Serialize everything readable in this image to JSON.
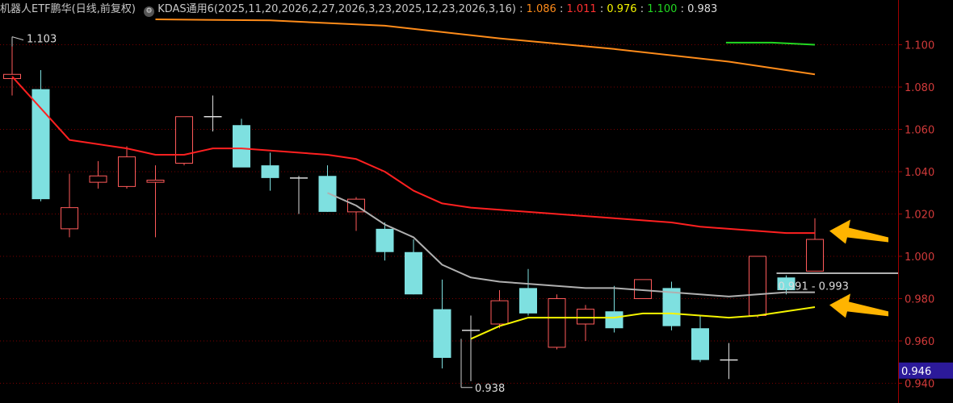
{
  "header": {
    "title": "机器人ETF鹏华(日线,前复权)",
    "indicator": "KDAS通用6(2025,11,20,2026,2,27,2026,3,23,2025,12,23,2026,3,16)",
    "values": [
      {
        "text": "1.086",
        "color": "#ff8c1a"
      },
      {
        "text": "1.011",
        "color": "#ff3030"
      },
      {
        "text": "0.976",
        "color": "#f5f500"
      },
      {
        "text": "1.100",
        "color": "#22d822"
      },
      {
        "text": "0.983",
        "color": "#dddddd"
      }
    ]
  },
  "colors": {
    "up": "#ff5a5a",
    "down": "#7ee0e0",
    "orange": "#ff8c1a",
    "red": "#ff2020",
    "yellow": "#f5f500",
    "green": "#22d822",
    "gray": "#b0b0b0",
    "grid": "#7a0000",
    "arrow": "#ffb400"
  },
  "chart_data": {
    "type": "candlestick",
    "ylim": [
      0.936,
      1.112
    ],
    "yticks": [
      "1.100",
      "1.080",
      "1.060",
      "1.040",
      "1.020",
      "1.000",
      "0.980",
      "0.960",
      "0.940"
    ],
    "current_price_label": "0.946",
    "annotations": {
      "high": "1.103",
      "low": "0.938",
      "range": "0.991 - 0.993"
    },
    "candles": [
      {
        "o": 1.084,
        "h": 1.103,
        "l": 1.076,
        "c": 1.086
      },
      {
        "o": 1.079,
        "h": 1.088,
        "l": 1.026,
        "c": 1.027
      },
      {
        "o": 1.013,
        "h": 1.039,
        "l": 1.009,
        "c": 1.023
      },
      {
        "o": 1.035,
        "h": 1.045,
        "l": 1.032,
        "c": 1.038
      },
      {
        "o": 1.033,
        "h": 1.052,
        "l": 1.032,
        "c": 1.047
      },
      {
        "o": 1.035,
        "h": 1.043,
        "l": 1.009,
        "c": 1.036
      },
      {
        "o": 1.044,
        "h": 1.066,
        "l": 1.043,
        "c": 1.066
      },
      {
        "o": 1.066,
        "h": 1.076,
        "l": 1.059,
        "c": 1.066
      },
      {
        "o": 1.062,
        "h": 1.065,
        "l": 1.045,
        "c": 1.042
      },
      {
        "o": 1.043,
        "h": 1.049,
        "l": 1.031,
        "c": 1.037
      },
      {
        "o": 1.037,
        "h": 1.038,
        "l": 1.02,
        "c": 1.037
      },
      {
        "o": 1.038,
        "h": 1.043,
        "l": 1.021,
        "c": 1.021
      },
      {
        "o": 1.021,
        "h": 1.028,
        "l": 1.012,
        "c": 1.027
      },
      {
        "o": 1.013,
        "h": 1.016,
        "l": 0.998,
        "c": 1.002
      },
      {
        "o": 1.002,
        "h": 1.008,
        "l": 0.982,
        "c": 0.982
      },
      {
        "o": 0.975,
        "h": 0.989,
        "l": 0.947,
        "c": 0.952
      },
      {
        "o": 0.965,
        "h": 0.972,
        "l": 0.941,
        "c": 0.965
      },
      {
        "o": 0.968,
        "h": 0.984,
        "l": 0.966,
        "c": 0.979
      },
      {
        "o": 0.985,
        "h": 0.994,
        "l": 0.972,
        "c": 0.973
      },
      {
        "o": 0.957,
        "h": 0.982,
        "l": 0.956,
        "c": 0.98
      },
      {
        "o": 0.968,
        "h": 0.977,
        "l": 0.96,
        "c": 0.975
      },
      {
        "o": 0.974,
        "h": 0.986,
        "l": 0.964,
        "c": 0.966
      },
      {
        "o": 0.98,
        "h": 0.989,
        "l": 0.98,
        "c": 0.989
      },
      {
        "o": 0.985,
        "h": 0.988,
        "l": 0.965,
        "c": 0.967
      },
      {
        "o": 0.966,
        "h": 0.972,
        "l": 0.95,
        "c": 0.951
      },
      {
        "o": 0.951,
        "h": 0.959,
        "l": 0.942,
        "c": 0.951
      },
      {
        "o": 0.972,
        "h": 1.0,
        "l": 0.971,
        "c": 1.0
      },
      {
        "o": 0.99,
        "h": 0.991,
        "l": 0.982,
        "c": 0.984
      },
      {
        "o": 0.993,
        "h": 1.018,
        "l": 0.993,
        "c": 1.008
      }
    ],
    "series": [
      {
        "color_key": "orange",
        "points": [
          [
            5,
            1.112
          ],
          [
            9,
            1.1115
          ],
          [
            13,
            1.109
          ],
          [
            17,
            1.103
          ],
          [
            21,
            1.098
          ],
          [
            25,
            1.092
          ],
          [
            28,
            1.086
          ]
        ]
      },
      {
        "color_key": "red",
        "points": [
          [
            0,
            1.085
          ],
          [
            1,
            1.07
          ],
          [
            2,
            1.055
          ],
          [
            3,
            1.053
          ],
          [
            4,
            1.051
          ],
          [
            5,
            1.048
          ],
          [
            6,
            1.048
          ],
          [
            7,
            1.051
          ],
          [
            8,
            1.051
          ],
          [
            9,
            1.05
          ],
          [
            10,
            1.049
          ],
          [
            11,
            1.048
          ],
          [
            12,
            1.046
          ],
          [
            13,
            1.04
          ],
          [
            14,
            1.031
          ],
          [
            15,
            1.025
          ],
          [
            16,
            1.023
          ],
          [
            17,
            1.022
          ],
          [
            18,
            1.021
          ],
          [
            19,
            1.02
          ],
          [
            20,
            1.019
          ],
          [
            21,
            1.018
          ],
          [
            22,
            1.017
          ],
          [
            23,
            1.016
          ],
          [
            24,
            1.014
          ],
          [
            25,
            1.013
          ],
          [
            26,
            1.012
          ],
          [
            27,
            1.011
          ],
          [
            28,
            1.011
          ]
        ]
      },
      {
        "color_key": "gray",
        "points": [
          [
            11,
            1.03
          ],
          [
            12,
            1.024
          ],
          [
            13,
            1.015
          ],
          [
            14,
            1.009
          ],
          [
            15,
            0.996
          ],
          [
            16,
            0.99
          ],
          [
            17,
            0.988
          ],
          [
            18,
            0.987
          ],
          [
            19,
            0.986
          ],
          [
            20,
            0.985
          ],
          [
            21,
            0.985
          ],
          [
            22,
            0.984
          ],
          [
            23,
            0.983
          ],
          [
            24,
            0.982
          ],
          [
            25,
            0.981
          ],
          [
            26,
            0.982
          ],
          [
            27,
            0.983
          ],
          [
            28,
            0.983
          ]
        ]
      },
      {
        "color_key": "yellow",
        "points": [
          [
            16,
            0.961
          ],
          [
            17,
            0.967
          ],
          [
            18,
            0.971
          ],
          [
            19,
            0.971
          ],
          [
            20,
            0.971
          ],
          [
            21,
            0.971
          ],
          [
            22,
            0.973
          ],
          [
            23,
            0.973
          ],
          [
            24,
            0.972
          ],
          [
            25,
            0.971
          ],
          [
            26,
            0.972
          ],
          [
            27,
            0.974
          ],
          [
            28,
            0.976
          ]
        ]
      },
      {
        "color_key": "green",
        "points": [
          [
            24.9,
            1.101
          ],
          [
            26.5,
            1.101
          ],
          [
            28,
            1.1
          ]
        ]
      }
    ],
    "level_line": {
      "value": 0.992,
      "from": 27,
      "color_key": "gray"
    }
  }
}
